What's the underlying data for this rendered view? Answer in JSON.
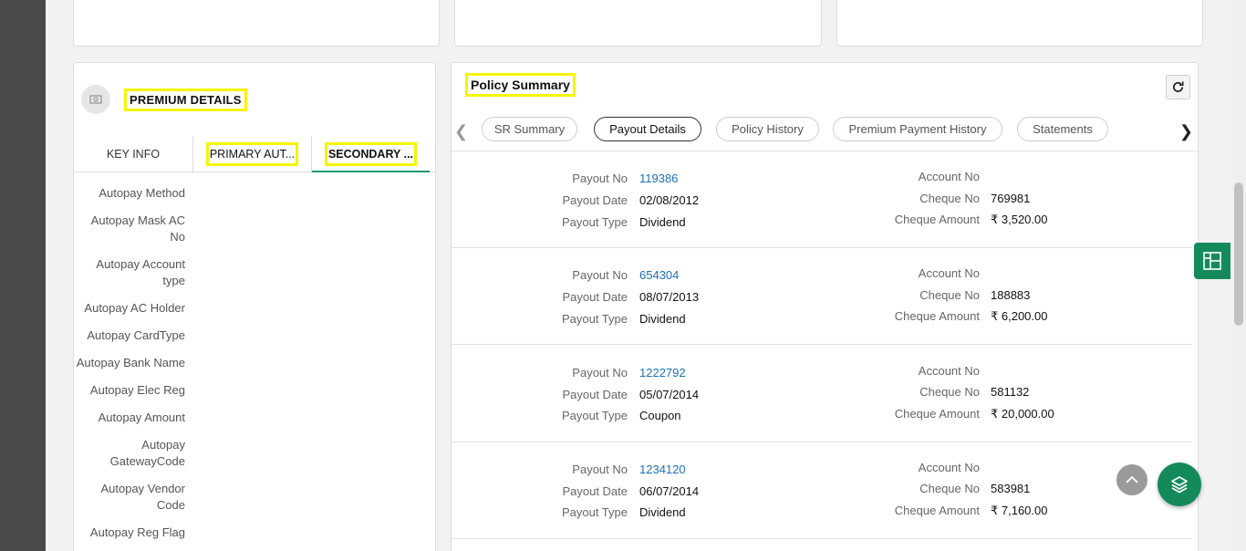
{
  "premium": {
    "avatar_icon": "money-icon",
    "title": "PREMIUM DETAILS",
    "tabs": [
      "KEY INFO",
      "PRIMARY AUT...",
      "SECONDARY ..."
    ],
    "active_tab": "SECONDARY ...",
    "fields": [
      "Autopay Method",
      "Autopay Mask AC No",
      "Autopay Account type",
      "Autopay AC Holder",
      "Autopay CardType",
      "Autopay Bank Name",
      "Autopay Elec Reg",
      "Autopay Amount",
      "Autopay GatewayCode",
      "Autopay Vendor Code",
      "Autopay Reg Flag"
    ]
  },
  "policy": {
    "title": "Policy Summary",
    "tabs": [
      "SR Summary",
      "Payout Details",
      "Policy History",
      "Premium Payment History",
      "Statements"
    ],
    "active_tab": "Payout Details",
    "labels": {
      "payout_no": "Payout No",
      "payout_date": "Payout Date",
      "payout_type": "Payout Type",
      "account_no": "Account No",
      "cheque_no": "Cheque No",
      "cheque_amount": "Cheque Amount"
    },
    "payouts": [
      {
        "payout_no": "119386",
        "payout_date": "02/08/2012",
        "payout_type": "Dividend",
        "account_no": "",
        "cheque_no": "769981",
        "cheque_amount": "₹ 3,520.00"
      },
      {
        "payout_no": "654304",
        "payout_date": "08/07/2013",
        "payout_type": "Dividend",
        "account_no": "",
        "cheque_no": "188883",
        "cheque_amount": "₹ 6,200.00"
      },
      {
        "payout_no": "1222792",
        "payout_date": "05/07/2014",
        "payout_type": "Coupon",
        "account_no": "",
        "cheque_no": "581132",
        "cheque_amount": "₹ 20,000.00"
      },
      {
        "payout_no": "1234120",
        "payout_date": "06/07/2014",
        "payout_type": "Dividend",
        "account_no": "",
        "cheque_no": "583981",
        "cheque_amount": "₹ 7,160.00"
      }
    ]
  },
  "colors": {
    "accent": "#148a5b",
    "highlight": "#f5f500",
    "link": "#1e6fb8"
  }
}
